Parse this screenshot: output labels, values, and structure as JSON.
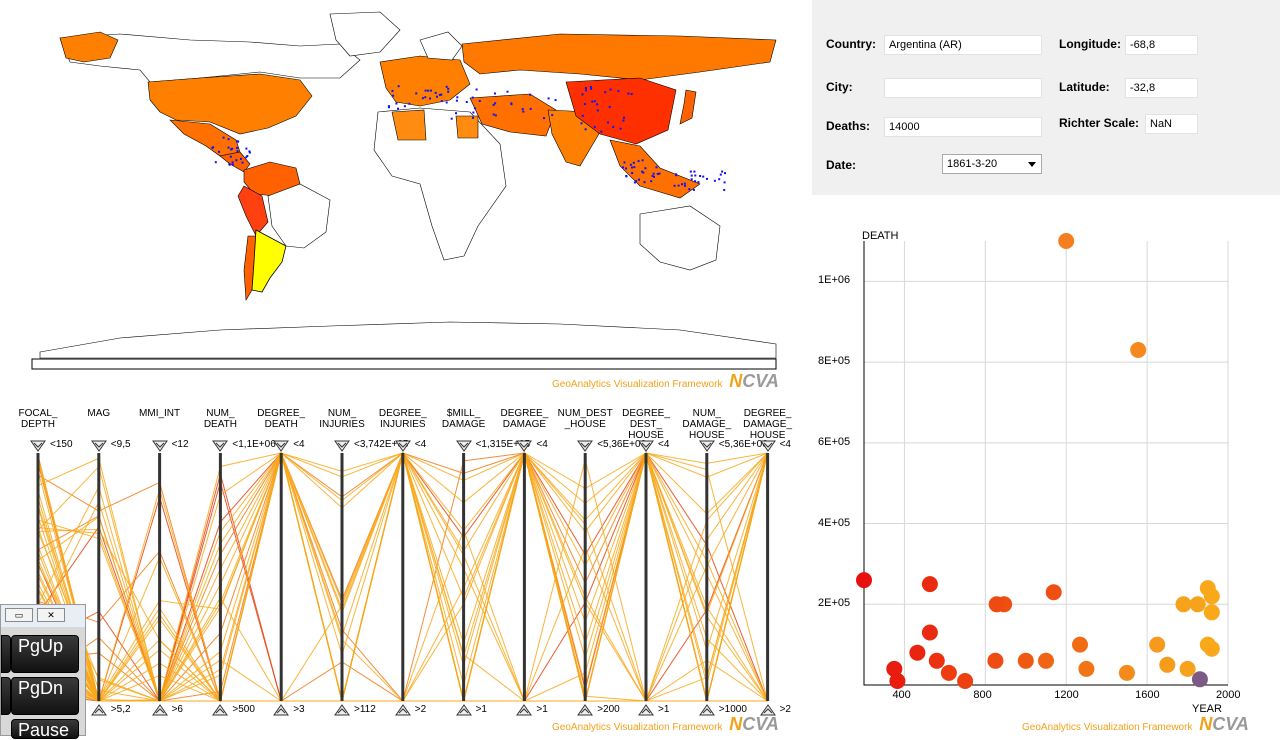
{
  "branding": {
    "framework_text": "GeoAnalytics Visualization Framework",
    "logo_n": "N",
    "logo_cva": "CVA"
  },
  "info": {
    "country_label": "Country:",
    "country_value": "Argentina (AR)",
    "city_label": "City:",
    "city_value": "",
    "deaths_label": "Deaths:",
    "deaths_value": "14000",
    "date_label": "Date:",
    "date_value": "1861-3-20",
    "longitude_label": "Longitude:",
    "longitude_value": "-68,8",
    "latitude_label": "Latitude:",
    "latitude_value": "-32,8",
    "richter_label": "Richter Scale:",
    "richter_value": "NaN"
  },
  "parallel_coords": {
    "axes": [
      {
        "title": "FOCAL_\nDEPTH",
        "top": "<150",
        "bottom": ""
      },
      {
        "title": "MAG",
        "top": "<9,5",
        "bottom": ">5,2"
      },
      {
        "title": "MMI_INT",
        "top": "<12",
        "bottom": ">6"
      },
      {
        "title": "NUM_\nDEATH",
        "top": "<1,1E+06",
        "bottom": ">500"
      },
      {
        "title": "DEGREE_\nDEATH",
        "top": "<4",
        "bottom": ">3"
      },
      {
        "title": "NUM_\nINJURIES",
        "top": "<3,742E+05",
        "bottom": ">112"
      },
      {
        "title": "DEGREE_\nINJURIES",
        "top": "<4",
        "bottom": ">2"
      },
      {
        "title": "$MILL_\nDAMAGE",
        "top": "<1,315E+05",
        "bottom": ">1"
      },
      {
        "title": "DEGREE_\nDAMAGE",
        "top": "<4",
        "bottom": ">1"
      },
      {
        "title": "NUM_DEST\n_HOUSE",
        "top": "<5,36E+06",
        "bottom": ">200"
      },
      {
        "title": "DEGREE_\nDEST_\nHOUSE",
        "top": "<4",
        "bottom": ">1"
      },
      {
        "title": "NUM_\nDAMAGE_\nHOUSE",
        "top": "<5,36E+06",
        "bottom": ">1000"
      },
      {
        "title": "DEGREE_\nDAMAGE_\nHOUSE",
        "top": "<4",
        "bottom": ">2"
      }
    ]
  },
  "keypad": {
    "pgup": "PgUp",
    "pgdn": "PgDn",
    "pause": "Pause",
    "close_glyph": "✕",
    "restore_glyph": "▭"
  },
  "colors": {
    "accent": "#f0a21a",
    "selected_country": "#ffff00",
    "highlight_point": "#7b5a86"
  },
  "chart_data": {
    "type": "scatter",
    "xlabel": "YEAR",
    "ylabel": "DEATH",
    "xlim": [
      200,
      2000
    ],
    "ylim": [
      0,
      1100000
    ],
    "xticks": [
      "400",
      "800",
      "1200",
      "1600",
      "2000"
    ],
    "yticks": [
      "2E+05",
      "4E+05",
      "6E+05",
      "8E+05",
      "1E+06"
    ],
    "grid": true,
    "points": [
      {
        "x": 1200,
        "y": 1100000,
        "color": "#f57f20"
      },
      {
        "x": 1556,
        "y": 830000,
        "color": "#f5891e"
      },
      {
        "x": 200,
        "y": 260000,
        "color": "#e91010"
      },
      {
        "x": 1138,
        "y": 230000,
        "color": "#ee4f12"
      },
      {
        "x": 1900,
        "y": 240000,
        "color": "#f9a81a"
      },
      {
        "x": 1920,
        "y": 220000,
        "color": "#f9a81a"
      },
      {
        "x": 1850,
        "y": 200000,
        "color": "#f6a21b"
      },
      {
        "x": 1780,
        "y": 200000,
        "color": "#f6a21b"
      },
      {
        "x": 1920,
        "y": 180000,
        "color": "#f9a81a"
      },
      {
        "x": 893,
        "y": 200000,
        "color": "#ee4f12"
      },
      {
        "x": 856,
        "y": 200000,
        "color": "#ee4a12"
      },
      {
        "x": 526,
        "y": 250000,
        "color": "#e92a10"
      },
      {
        "x": 526,
        "y": 130000,
        "color": "#e92a10"
      },
      {
        "x": 1268,
        "y": 100000,
        "color": "#f06d15"
      },
      {
        "x": 1900,
        "y": 100000,
        "color": "#f9a81a"
      },
      {
        "x": 1650,
        "y": 100000,
        "color": "#f59a1c"
      },
      {
        "x": 1920,
        "y": 90000,
        "color": "#f9a81a"
      },
      {
        "x": 464,
        "y": 80000,
        "color": "#e92510"
      },
      {
        "x": 350,
        "y": 40000,
        "color": "#e91c10"
      },
      {
        "x": 365,
        "y": 5000,
        "color": "#e91c10"
      },
      {
        "x": 560,
        "y": 60000,
        "color": "#eb3110"
      },
      {
        "x": 620,
        "y": 30000,
        "color": "#ec3c10"
      },
      {
        "x": 700,
        "y": 5000,
        "color": "#ec4011"
      },
      {
        "x": 850,
        "y": 60000,
        "color": "#ee4c12"
      },
      {
        "x": 1000,
        "y": 60000,
        "color": "#ef5a13"
      },
      {
        "x": 1100,
        "y": 60000,
        "color": "#f06514"
      },
      {
        "x": 1300,
        "y": 40000,
        "color": "#f17516"
      },
      {
        "x": 1500,
        "y": 30000,
        "color": "#f48b1a"
      },
      {
        "x": 1700,
        "y": 50000,
        "color": "#f69c1c"
      },
      {
        "x": 1800,
        "y": 40000,
        "color": "#f7a21d"
      },
      {
        "x": 1861,
        "y": 14000,
        "color": "#7b5a86"
      }
    ]
  }
}
